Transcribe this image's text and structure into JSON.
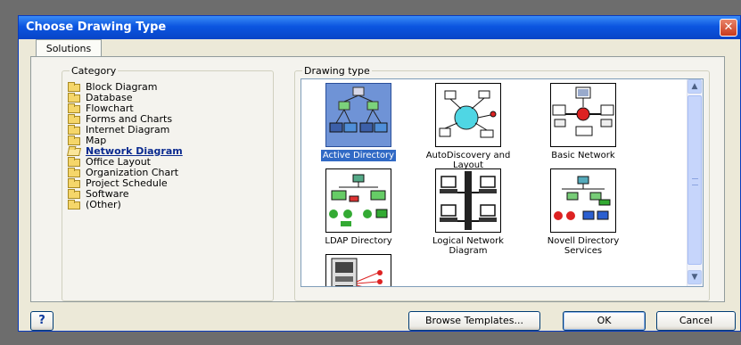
{
  "window": {
    "title": "Choose Drawing Type",
    "close_glyph": "✕"
  },
  "tabs": [
    {
      "label": "Solutions"
    }
  ],
  "category": {
    "legend": "Category",
    "items": [
      {
        "label": "Block Diagram",
        "selected": false
      },
      {
        "label": "Database",
        "selected": false
      },
      {
        "label": "Flowchart",
        "selected": false
      },
      {
        "label": "Forms and Charts",
        "selected": false
      },
      {
        "label": "Internet Diagram",
        "selected": false
      },
      {
        "label": "Map",
        "selected": false
      },
      {
        "label": "Network Diagram",
        "selected": true
      },
      {
        "label": "Office Layout",
        "selected": false
      },
      {
        "label": "Organization Chart",
        "selected": false
      },
      {
        "label": "Project Schedule",
        "selected": false
      },
      {
        "label": "Software",
        "selected": false
      },
      {
        "label": "(Other)",
        "selected": false
      }
    ]
  },
  "drawing_type": {
    "legend": "Drawing type",
    "items": [
      {
        "label": "Active Directory",
        "selected": true,
        "icon": "active-directory-icon"
      },
      {
        "label": "AutoDiscovery and Layout",
        "selected": false,
        "icon": "autodiscovery-icon"
      },
      {
        "label": "Basic Network",
        "selected": false,
        "icon": "basic-network-icon"
      },
      {
        "label": "LDAP Directory",
        "selected": false,
        "icon": "ldap-directory-icon"
      },
      {
        "label": "Logical Network Diagram",
        "selected": false,
        "icon": "logical-network-icon"
      },
      {
        "label": "Novell Directory Services",
        "selected": false,
        "icon": "novell-directory-icon"
      },
      {
        "label": "",
        "selected": false,
        "icon": "rack-diagram-icon"
      }
    ]
  },
  "buttons": {
    "help": "?",
    "browse": "Browse Templates...",
    "ok": "OK",
    "cancel": "Cancel"
  },
  "colors": {
    "title_bar": "#0b55e0",
    "selection": "#316ac5",
    "dialog_bg": "#ece9d8"
  }
}
